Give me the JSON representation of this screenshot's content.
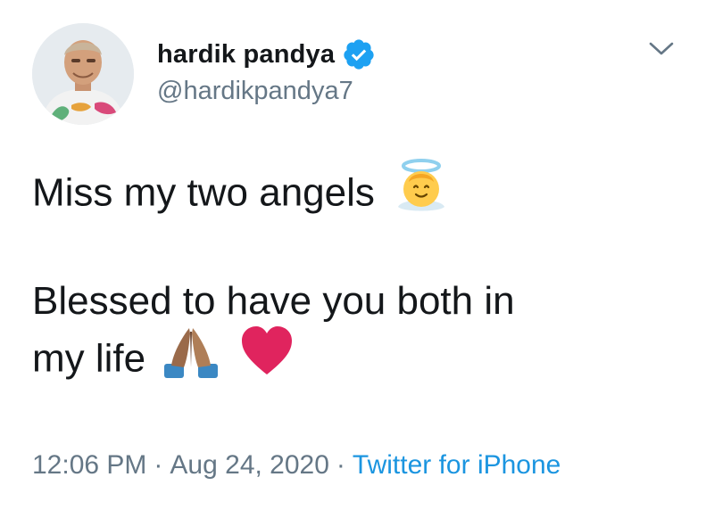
{
  "tweet": {
    "author": {
      "name": "hardik pandya",
      "handle": "@hardikpandya7",
      "verified": true
    },
    "text": {
      "line1": "Miss my two angels",
      "line2": "Blessed to have you both in",
      "line3": "my life"
    },
    "emojis": [
      "smiling-face-with-halo-icon",
      "folded-hands-icon",
      "red-heart-icon"
    ],
    "meta": {
      "time": "12:06 PM",
      "separator": "·",
      "date": "Aug 24, 2020",
      "source": "Twitter for iPhone"
    }
  },
  "colors": {
    "text": "#14171a",
    "secondary": "#657786",
    "link": "#1b95e0",
    "verified": "#1da1f2",
    "heart": "#e0245e"
  }
}
